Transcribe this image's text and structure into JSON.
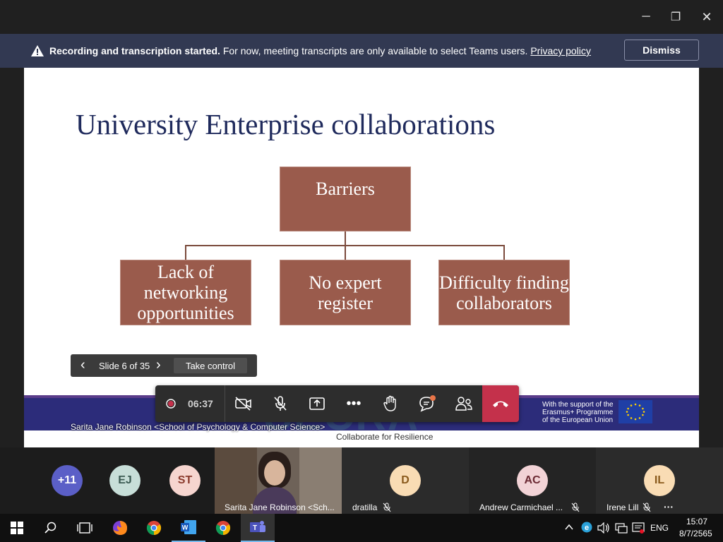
{
  "window": {
    "minimize": "─",
    "maximize": "❐",
    "close": "✕"
  },
  "banner": {
    "bold_text": "Recording and transcription started.",
    "text": "For now, meeting transcripts are only available to select Teams users.",
    "link": "Privacy policy",
    "dismiss_label": "Dismiss"
  },
  "slide": {
    "title": "University Enterprise collaborations",
    "root_box": "Barriers",
    "children": [
      "Lack of networking opportunities",
      "No expert register",
      "Difficulty finding collaborators"
    ],
    "footer_logo": "SECRA",
    "footer_tagline": "Collaborate for Resilience",
    "eu_support": "With the support of the Erasmus+ Programme of the European Union",
    "presenter_overlay": "Sarita Jane Robinson <School of Psychology & Computer Science>"
  },
  "slide_nav": {
    "counter": "Slide 6 of 35",
    "take_control": "Take control",
    "prev": "‹",
    "next": "›"
  },
  "call_controls": {
    "timer": "06:37"
  },
  "participants": {
    "overflow": "+11",
    "tiles": [
      {
        "initials": "EJ",
        "color": "#c7ded8",
        "fg": "#3b5a52"
      },
      {
        "initials": "ST",
        "color": "#f6d5cf",
        "fg": "#8a3a2c"
      },
      {
        "name": "Sarita Jane Robinson <Sch..."
      },
      {
        "initials": "D",
        "name": "dratilla",
        "color": "#f9dcb4",
        "fg": "#8a5a1c"
      },
      {
        "initials": "AC",
        "name": "Andrew Carmichael ...",
        "color": "#f2d3d6",
        "fg": "#6b2a33"
      },
      {
        "initials": "IL",
        "name": "Irene Lill",
        "color": "#f9dcb4",
        "fg": "#8a5a1c"
      }
    ],
    "more": "···"
  },
  "taskbar": {
    "lang": "ENG",
    "time": "15:07",
    "date": "8/7/2565"
  }
}
